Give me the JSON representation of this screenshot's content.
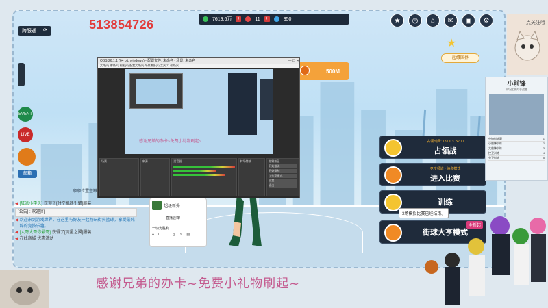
{
  "stream_id": "513854726",
  "resource_bar": {
    "coins": "7619.6万",
    "gems": "11",
    "energy": "350"
  },
  "top_right_icons": [
    "activity-icon",
    "clock-icon",
    "shop-icon",
    "gift-icon",
    "bag-icon",
    "settings-icon"
  ],
  "left_tab": {
    "label": "跨服通"
  },
  "side_buttons": [
    {
      "name": "event-button",
      "label": "EVENT"
    },
    {
      "name": "live-button",
      "label": "LIVE"
    },
    {
      "name": "feature-button",
      "label": ""
    },
    {
      "name": "mail-button",
      "label": "邮箱"
    }
  ],
  "obs": {
    "title": "OBS 26.1.1 (64 bit, windows) - 配置文件: 未命名 - 场景: 未命名",
    "menu": "文件(F)  编辑(E)  视图(V)  配置文件(P)  场景集合(S)  工具(T)  帮助(H)",
    "panels": [
      "场景",
      "来源",
      "混音器",
      "转场特效",
      "控制按钮"
    ],
    "controls": [
      "开始推流",
      "开始录制",
      "工作室模式",
      "设置",
      "退出"
    ]
  },
  "price_button": {
    "label": "500M"
  },
  "vip_badge": {
    "label": "超级国界"
  },
  "modes": [
    {
      "title": "占领战",
      "sub": "占领时间: 18:00 ~ 24:00",
      "hot": ""
    },
    {
      "title": "进入比赛",
      "sub": "竞技频道 · 待命模式",
      "hot": ""
    },
    {
      "title": "训练",
      "sub": "",
      "hot": ""
    },
    {
      "title": "街球大亨模式",
      "sub": "",
      "hot": "全新起"
    }
  ],
  "tooltip": "3场模拟比赛已经结束。",
  "friend_position": "咿咿位置空缺",
  "chat": [
    {
      "type": "msg",
      "user": "[狂派小李头]",
      "text": "获得了[时空机器引擎]服装"
    },
    {
      "type": "notice",
      "text": "[公告] : 欢迎[!!]"
    },
    {
      "type": "msg",
      "user": "",
      "text": "欢迎来到游戏世界，在这里与好友一起畅玩街头篮球，享受最纯粹的竞技乐趣。"
    },
    {
      "type": "msg",
      "user": "[大哥大哥你最哥]",
      "text": "获得了[流星之翼]服装"
    },
    {
      "type": "msg",
      "user": "",
      "text": "在线商城 优惠活动"
    }
  ],
  "card": {
    "title": "超级新秀",
    "info": "直播验样!",
    "stat": "一切为胜利",
    "count": "0"
  },
  "subtitle": "感谢兄弟的办卡~免费小礼物刷起~",
  "follow_text": "点关注哦",
  "pip": {
    "name": "小前锋",
    "caption": "半场比赛对手战胜",
    "ranks": [
      {
        "label": "中锋训练赛",
        "value": "1"
      },
      {
        "label": "小前锋训练",
        "value": "2"
      },
      {
        "label": "大前锋训练",
        "value": "3"
      },
      {
        "label": "控卫训练",
        "value": "4"
      },
      {
        "label": "分卫训练",
        "value": "5"
      }
    ]
  }
}
